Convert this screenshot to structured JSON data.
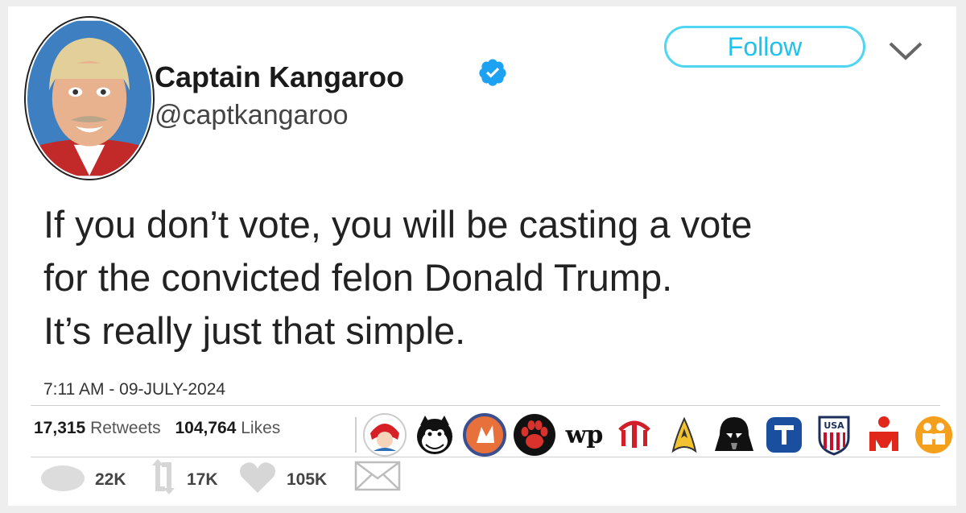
{
  "tweet": {
    "display_name": "Captain Kangaroo",
    "handle": "@captkangaroo",
    "follow_label": "Follow",
    "text_lines": [
      "If you don’t vote, you will be casting a vote",
      "for the convicted felon Donald Trump.",
      "It’s really just that simple."
    ],
    "timestamp": "7:11 AM - 09-JULY-2024"
  },
  "stats": {
    "retweets_count": "17,315",
    "retweets_label": "Retweets",
    "likes_count": "104,764",
    "likes_label": "Likes"
  },
  "badges": [
    "wendys-logo-icon",
    "felix-the-cat-icon",
    "mascot-seal-icon",
    "paw-print-icon",
    "washington-post-logo-icon",
    "trident-logo-icon",
    "starfleet-insignia-icon",
    "darth-vader-icon",
    "t-badge-icon",
    "usa-crest-icon",
    "ironman-logo-icon",
    "family-circle-icon"
  ],
  "actions": {
    "replies": "22K",
    "retweets": "17K",
    "likes": "105K"
  },
  "colors": {
    "follow_accent": "#1ec2ec",
    "verified": "#1da1f2"
  }
}
